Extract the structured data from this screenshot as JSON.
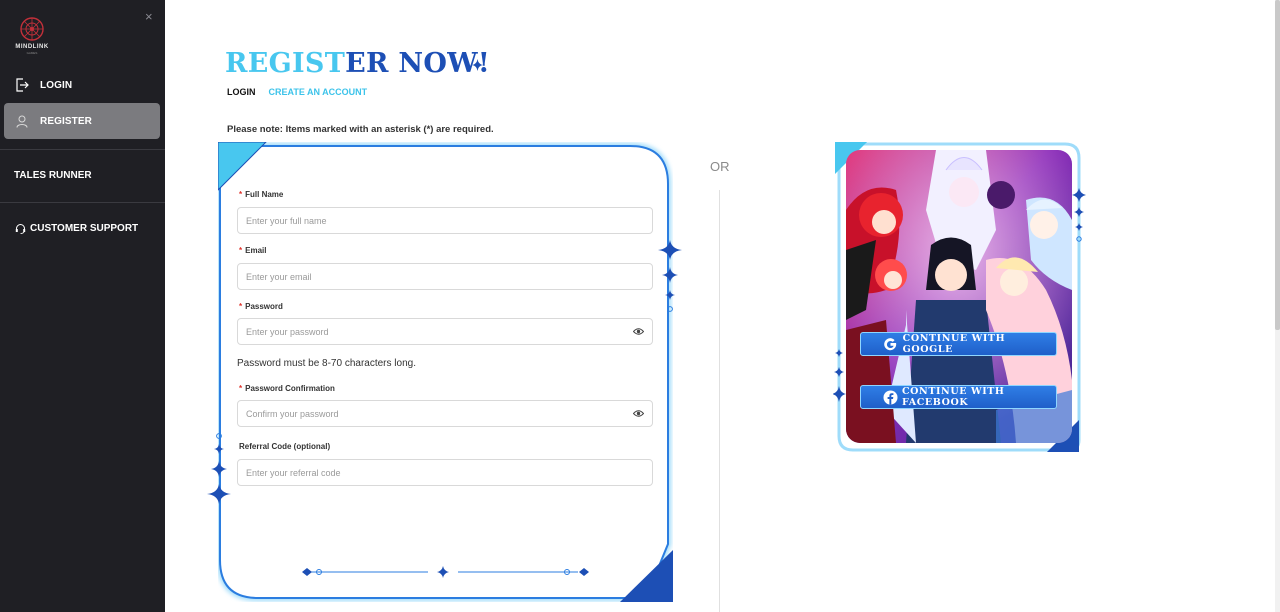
{
  "sidebar": {
    "logo_text": "MINDLINK",
    "logo_sub": "GAMES",
    "close_glyph": "×",
    "items": [
      {
        "label": "LOGIN",
        "icon": "logout-icon"
      },
      {
        "label": "REGISTER",
        "icon": "user-icon",
        "active": true
      }
    ],
    "tales_runner": "TALES RUNNER",
    "support": {
      "label": "CUSTOMER SUPPORT",
      "icon": "headset-icon"
    }
  },
  "page": {
    "title_highlight": "REGIST",
    "title_rest": "ER NOW!",
    "tabs": {
      "login": "LOGIN",
      "create": "CREATE AN ACCOUNT"
    },
    "note": "Please note: Items marked with an asterisk (*) are required."
  },
  "form": {
    "full_name": {
      "label": "Full Name",
      "required": "*",
      "placeholder": "Enter your full name"
    },
    "email": {
      "label": "Email",
      "required": "*",
      "placeholder": "Enter your email"
    },
    "password": {
      "label": "Password",
      "required": "*",
      "placeholder": "Enter your password"
    },
    "password_hint": "Password must be 8-70 characters long.",
    "password_confirmation": {
      "label": "Password Confirmation",
      "required": "*",
      "placeholder": "Confirm your password"
    },
    "referral": {
      "label": "Referral Code (optional)",
      "placeholder": "Enter your referral code"
    }
  },
  "or_label": "OR",
  "sso": {
    "google": "CONTINUE WITH GOOGLE",
    "facebook": "CONTINUE WITH FACEBOOK"
  },
  "colors": {
    "sidebar_bg": "#1f1f24",
    "active_item": "#7b7b7f",
    "accent_blue": "#1d4fb5",
    "accent_cyan": "#48c7ef",
    "required": "#e0342c"
  }
}
